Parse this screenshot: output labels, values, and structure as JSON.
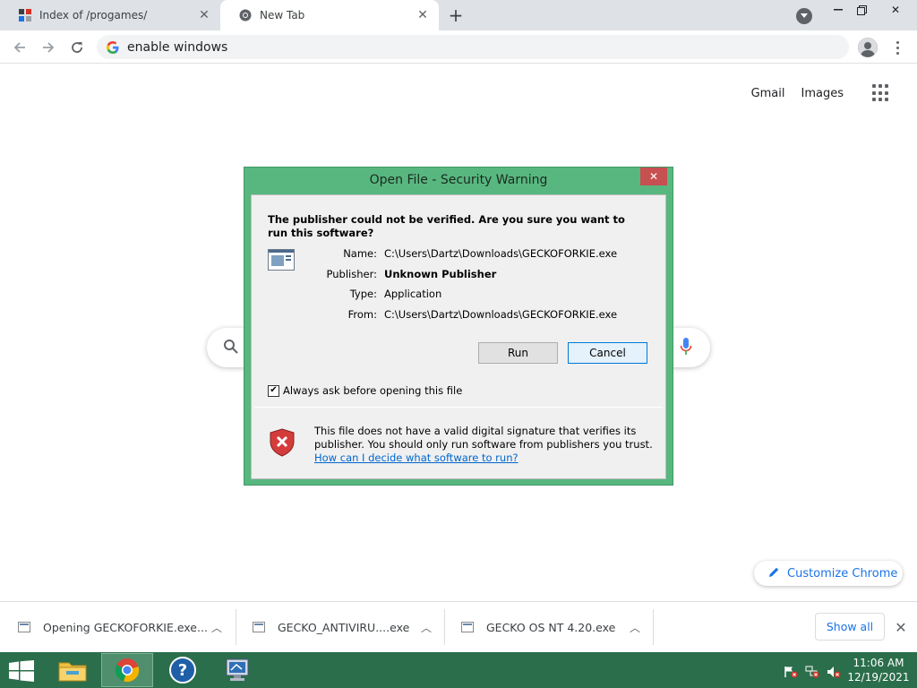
{
  "browser": {
    "tabs": [
      {
        "title": "Index of /progames/",
        "active": false
      },
      {
        "title": "New Tab",
        "active": true
      }
    ],
    "omnibox": {
      "value": "enable windows"
    }
  },
  "page": {
    "links": {
      "gmail": "Gmail",
      "images": "Images"
    },
    "customize_label": "Customize Chrome"
  },
  "dialog": {
    "title": "Open File - Security Warning",
    "close_glyph": "✕",
    "headline": "The publisher could not be verified.  Are you sure you want to run this software?",
    "fields": [
      {
        "label": "Name:",
        "value": "C:\\Users\\Dartz\\Downloads\\GECKOFORKIE.exe",
        "bold": false
      },
      {
        "label": "Publisher:",
        "value": "Unknown Publisher",
        "bold": true
      },
      {
        "label": "Type:",
        "value": "Application",
        "bold": false
      },
      {
        "label": "From:",
        "value": "C:\\Users\\Dartz\\Downloads\\GECKOFORKIE.exe",
        "bold": false
      }
    ],
    "run_label": "Run",
    "cancel_label": "Cancel",
    "always_ask": {
      "label": "Always ask before opening this file",
      "checked": true
    },
    "signature_text": "This file does not have a valid digital signature that verifies its publisher.  You should only run software from publishers you trust.",
    "help_link": "How can I decide what software to run?"
  },
  "downloads": {
    "items": [
      {
        "name": "Opening GECKOFORKIE.exe..."
      },
      {
        "name": "GECKO_ANTIVIRU....exe"
      },
      {
        "name": "GECKO OS NT 4.20.exe"
      }
    ],
    "show_all_label": "Show all"
  },
  "taskbar": {
    "apps": [
      "file-explorer",
      "chrome",
      "help",
      "my-computer"
    ],
    "clock": {
      "time": "11:06 AM",
      "date": "12/19/2021"
    }
  },
  "colors": {
    "dialog_frame": "#58b77f",
    "taskbar": "#2b6e4b",
    "accent_blue": "#1a73e8",
    "close_red": "#c75050"
  }
}
